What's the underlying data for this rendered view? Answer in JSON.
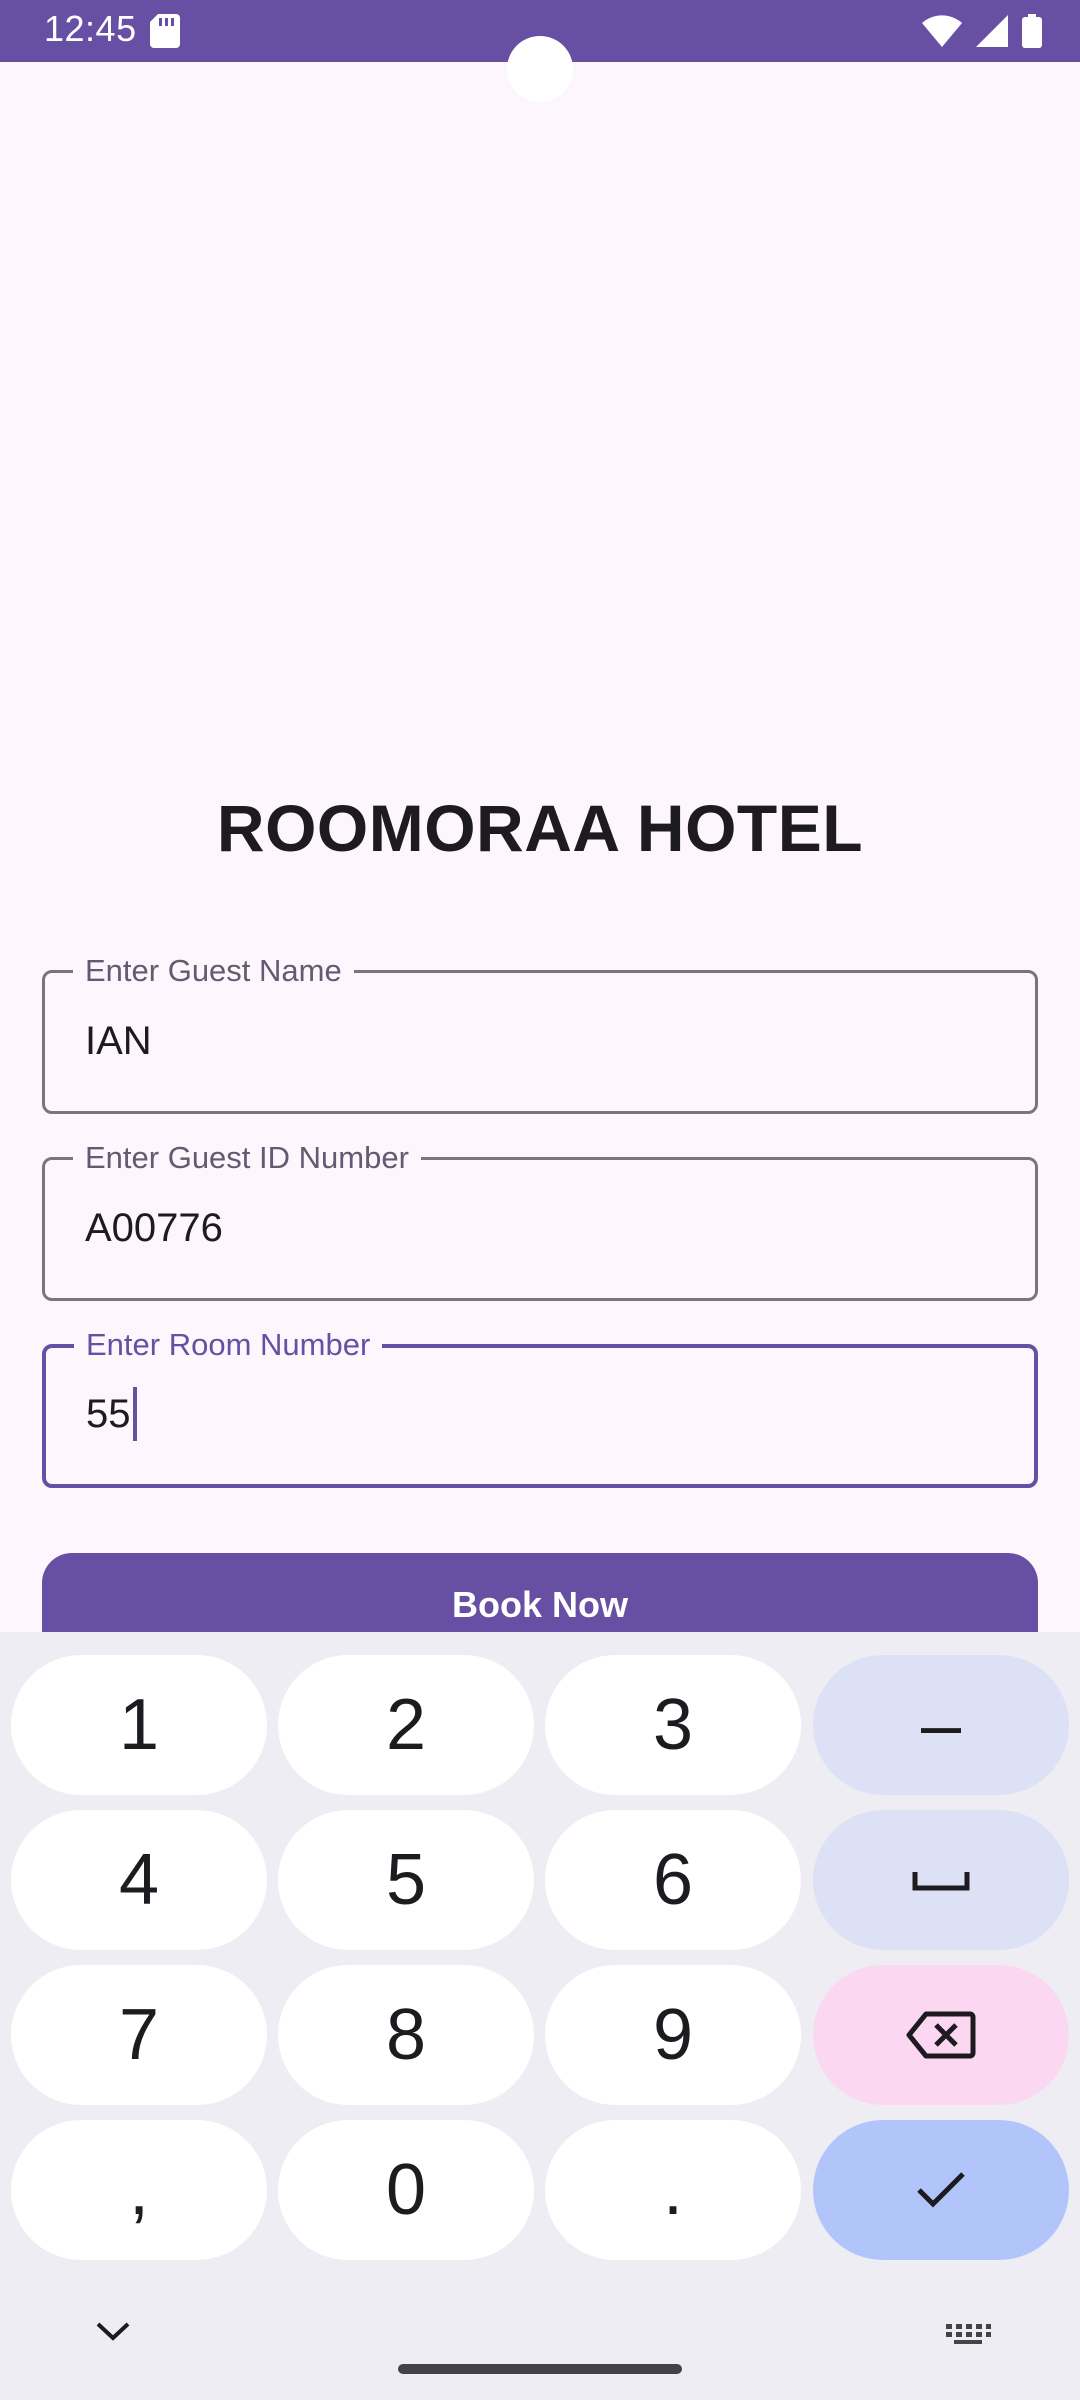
{
  "status_bar": {
    "time": "12:45",
    "icons": [
      "sd-card-icon",
      "wifi-icon",
      "cellular-signal-icon",
      "battery-icon"
    ],
    "color": "#6750a4"
  },
  "app": {
    "title": "ROOMORAA HOTEL",
    "fields": [
      {
        "label": "Enter Guest Name",
        "value": "IAN",
        "focused": false
      },
      {
        "label": "Enter Guest ID Number",
        "value": "A00776",
        "focused": false
      },
      {
        "label": "Enter Room Number",
        "value": "55",
        "focused": true
      }
    ],
    "book_button_label": "Book Now",
    "accent_color": "#6750a4"
  },
  "keyboard": {
    "rows": [
      [
        "1",
        "2",
        "3",
        "–"
      ],
      [
        "4",
        "5",
        "6",
        "space-key"
      ],
      [
        "7",
        "8",
        "9",
        "backspace-key"
      ],
      [
        ",",
        "0",
        ".",
        "enter-check-key"
      ]
    ],
    "bottom_icons": [
      "hide-keyboard-chevron-icon",
      "keyboard-switch-icon"
    ]
  }
}
